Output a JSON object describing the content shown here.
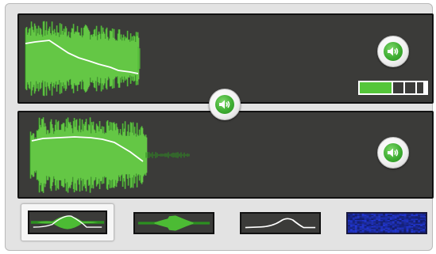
{
  "app": {
    "name": "audio-waveform-mixer"
  },
  "colors": {
    "panel_bg": "#3b3b39",
    "wave_light": "#7ed957",
    "wave_mid": "#4cbb34",
    "wave_dark": "#2c8f20",
    "envelope": "#ffffff",
    "accent": "#55c63a",
    "spectrogram": "#1d2aa0"
  },
  "tracks": [
    {
      "id": "track-1",
      "icon": "speaker-icon",
      "level_segments_total": 4,
      "level_segments_lit": 2
    },
    {
      "id": "track-2",
      "icon": "speaker-icon"
    }
  ],
  "master": {
    "icon": "speaker-icon"
  },
  "view_tabs": [
    {
      "id": "waveform-with-envelope",
      "icon": "waveform-envelope-icon",
      "selected": true
    },
    {
      "id": "waveform",
      "icon": "waveform-icon",
      "selected": false
    },
    {
      "id": "envelope",
      "icon": "envelope-curve-icon",
      "selected": false
    },
    {
      "id": "spectrogram",
      "icon": "spectrogram-icon",
      "selected": false
    }
  ]
}
